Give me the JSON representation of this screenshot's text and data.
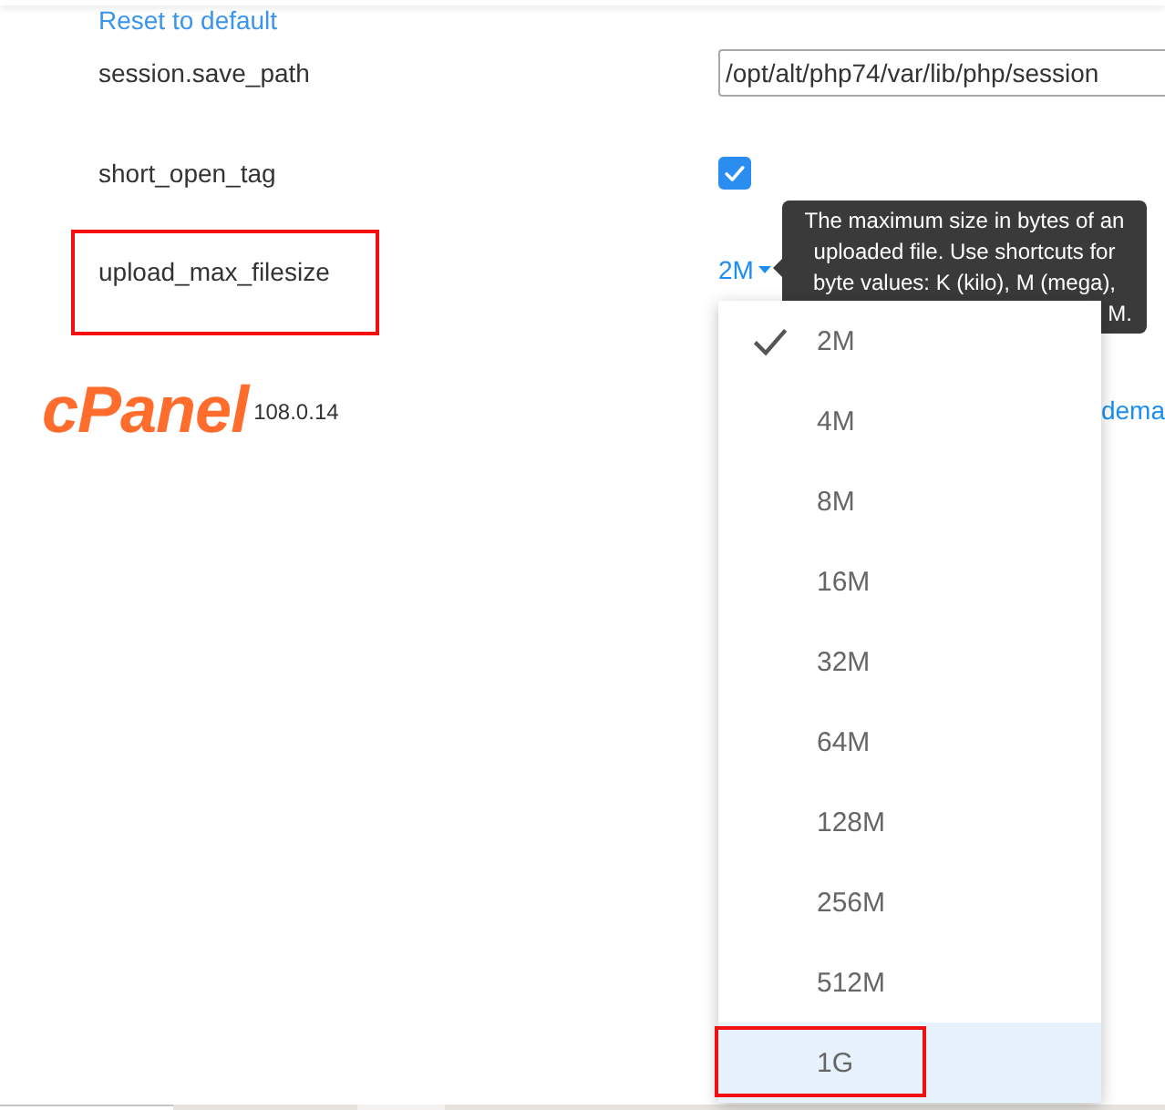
{
  "top_link": "Reset to default",
  "settings": [
    {
      "kind": "text",
      "name": "session.save_path",
      "value": "/opt/alt/php74/var/lib/php/session"
    },
    {
      "kind": "checkbox",
      "name": "short_open_tag",
      "checked": true
    },
    {
      "kind": "dropdown",
      "name": "upload_max_filesize",
      "marked": true,
      "value": "2M",
      "expanded": true,
      "tooltip": {
        "lines": [
          "The maximum size in bytes of an",
          "uploaded file. Use shortcuts for",
          "byte values: K (kilo), M (mega),"
        ],
        "tail": "M."
      },
      "options": [
        {
          "label": "2M",
          "selected": true,
          "hovered": false,
          "marked": false
        },
        {
          "label": "4M",
          "selected": false,
          "hovered": false,
          "marked": false
        },
        {
          "label": "8M",
          "selected": false,
          "hovered": false,
          "marked": false
        },
        {
          "label": "16M",
          "selected": false,
          "hovered": false,
          "marked": false
        },
        {
          "label": "32M",
          "selected": false,
          "hovered": false,
          "marked": false
        },
        {
          "label": "64M",
          "selected": false,
          "hovered": false,
          "marked": false
        },
        {
          "label": "128M",
          "selected": false,
          "hovered": false,
          "marked": false
        },
        {
          "label": "256M",
          "selected": false,
          "hovered": false,
          "marked": false
        },
        {
          "label": "512M",
          "selected": false,
          "hovered": false,
          "marked": false
        },
        {
          "label": "1G",
          "selected": false,
          "hovered": true,
          "marked": true
        }
      ]
    }
  ],
  "footer": {
    "logo": "cPanel",
    "version": "108.0.14",
    "link": "dema"
  }
}
